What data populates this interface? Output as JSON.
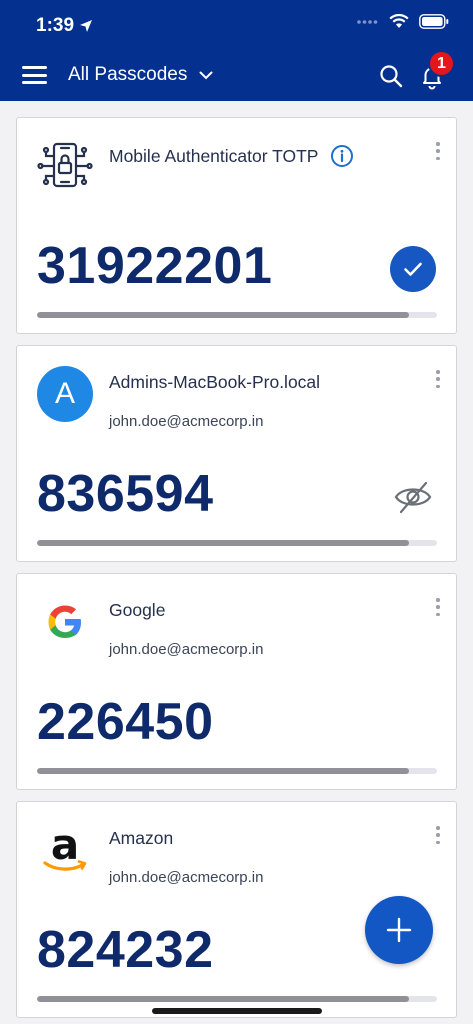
{
  "status_bar": {
    "time": "1:39"
  },
  "header": {
    "title": "All Passcodes",
    "notification_count": "1"
  },
  "colors": {
    "brand": "#04308f",
    "accent": "#1257c3",
    "code": "#0e2a6b"
  },
  "cards": [
    {
      "title": "Mobile Authenticator TOTP",
      "subtitle": "",
      "code": "31922201",
      "progress": 0.93,
      "logo": "phone-lock-icon",
      "status": "check-icon"
    },
    {
      "title": "Admins-MacBook-Pro.local",
      "subtitle": "john.doe@acmecorp.in",
      "code": "836594",
      "progress": 0.93,
      "logo": "avatar-letter",
      "avatar_letter": "A",
      "status": "eye-off-icon"
    },
    {
      "title": "Google",
      "subtitle": "john.doe@acmecorp.in",
      "code": "226450",
      "progress": 0.93,
      "logo": "google-logo-icon"
    },
    {
      "title": "Amazon",
      "subtitle": "john.doe@acmecorp.in",
      "code": "824232",
      "progress": 0.93,
      "logo": "amazon-logo-icon"
    }
  ]
}
